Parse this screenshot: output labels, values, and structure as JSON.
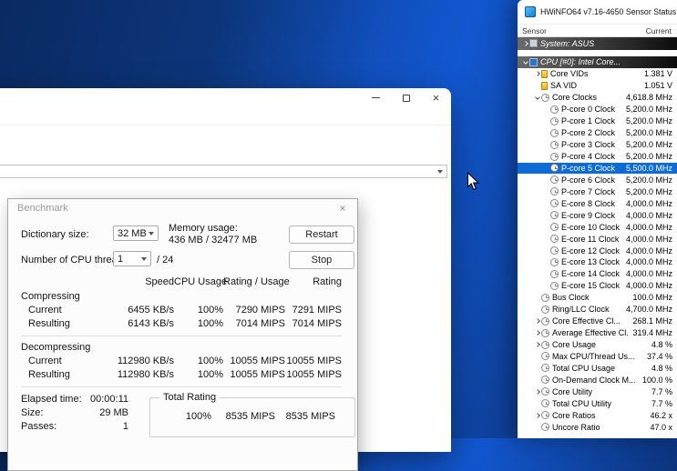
{
  "colors": {
    "desktop_blue": "#1257d0",
    "selection_blue": "#0d6bd7",
    "group_row_dark": "#0c0c0c",
    "vid_icon_yellow": "#f0b01e"
  },
  "main_window": {
    "close_glyph": "×"
  },
  "benchmark": {
    "title": "Benchmark",
    "close_glyph": "×",
    "dictionary_label": "Dictionary size:",
    "dictionary_value": "32 MB",
    "memory_label": "Memory usage:",
    "memory_value": "436 MB / 32477 MB",
    "restart_label": "Restart",
    "threads_label": "Number of CPU threads:",
    "threads_value": "1",
    "threads_total": "/ 24",
    "stop_label": "Stop",
    "table": {
      "headers": [
        "Speed",
        "CPU Usage",
        "Rating / Usage",
        "Rating"
      ],
      "sections": [
        {
          "name": "Compressing",
          "rows": [
            {
              "label": "Current",
              "speed": "6455 KB/s",
              "cpu": "100%",
              "rating_usage": "7290 MIPS",
              "rating": "7291 MIPS"
            },
            {
              "label": "Resulting",
              "speed": "6143 KB/s",
              "cpu": "100%",
              "rating_usage": "7014 MIPS",
              "rating": "7014 MIPS"
            }
          ]
        },
        {
          "name": "Decompressing",
          "rows": [
            {
              "label": "Current",
              "speed": "112980 KB/s",
              "cpu": "100%",
              "rating_usage": "10055 MIPS",
              "rating": "10055 MIPS"
            },
            {
              "label": "Resulting",
              "speed": "112980 KB/s",
              "cpu": "100%",
              "rating_usage": "10055 MIPS",
              "rating": "10055 MIPS"
            }
          ]
        }
      ]
    },
    "stats": [
      {
        "label": "Elapsed time:",
        "value": "00:00:11"
      },
      {
        "label": "Size:",
        "value": "29 MB"
      },
      {
        "label": "Passes:",
        "value": "1"
      }
    ],
    "total_rating": {
      "legend": "Total Rating",
      "cpu": "100%",
      "rating_usage": "8535 MIPS",
      "rating": "8535 MIPS"
    }
  },
  "hwinfo": {
    "title": "HWiNFO64 v7.16-4650 Sensor Status",
    "columns": {
      "sensor": "Sensor",
      "current": "Current"
    },
    "rows": [
      {
        "kind": "group",
        "chevron": "right",
        "icon": "system",
        "label": "System: ASUS"
      },
      {
        "kind": "gap"
      },
      {
        "kind": "group",
        "chevron": "down",
        "icon": "cpu",
        "label": "CPU [#0]: Intel Core..."
      },
      {
        "kind": "item",
        "indent": 1,
        "chevron": "right",
        "icon": "vid",
        "label": "Core VIDs",
        "value": "1.381 V"
      },
      {
        "kind": "item",
        "indent": 1,
        "icon": "vid",
        "label": "SA VID",
        "value": "1.051 V"
      },
      {
        "kind": "item",
        "indent": 1,
        "chevron": "down",
        "icon": "clock",
        "label": "Core Clocks",
        "value": "4,618.8 MHz"
      },
      {
        "kind": "item",
        "indent": 2,
        "icon": "clock",
        "label": "P-core 0 Clock",
        "value": "5,200.0 MHz"
      },
      {
        "kind": "item",
        "indent": 2,
        "icon": "clock",
        "label": "P-core 1 Clock",
        "value": "5,200.0 MHz"
      },
      {
        "kind": "item",
        "indent": 2,
        "icon": "clock",
        "label": "P-core 2 Clock",
        "value": "5,200.0 MHz"
      },
      {
        "kind": "item",
        "indent": 2,
        "icon": "clock",
        "label": "P-core 3 Clock",
        "value": "5,200.0 MHz"
      },
      {
        "kind": "item",
        "indent": 2,
        "icon": "clock",
        "label": "P-core 4 Clock",
        "value": "5,200.0 MHz"
      },
      {
        "kind": "item",
        "indent": 2,
        "icon": "clock",
        "label": "P-core 5 Clock",
        "value": "5,500.0 MHz",
        "selected": true
      },
      {
        "kind": "item",
        "indent": 2,
        "icon": "clock",
        "label": "P-core 6 Clock",
        "value": "5,200.0 MHz"
      },
      {
        "kind": "item",
        "indent": 2,
        "icon": "clock",
        "label": "P-core 7 Clock",
        "value": "5,200.0 MHz"
      },
      {
        "kind": "item",
        "indent": 2,
        "icon": "clock",
        "label": "E-core 8 Clock",
        "value": "4,000.0 MHz"
      },
      {
        "kind": "item",
        "indent": 2,
        "icon": "clock",
        "label": "E-core 9 Clock",
        "value": "4,000.0 MHz"
      },
      {
        "kind": "item",
        "indent": 2,
        "icon": "clock",
        "label": "E-core 10 Clock",
        "value": "4,000.0 MHz"
      },
      {
        "kind": "item",
        "indent": 2,
        "icon": "clock",
        "label": "E-core 11 Clock",
        "value": "4,000.0 MHz"
      },
      {
        "kind": "item",
        "indent": 2,
        "icon": "clock",
        "label": "E-core 12 Clock",
        "value": "4,000.0 MHz"
      },
      {
        "kind": "item",
        "indent": 2,
        "icon": "clock",
        "label": "E-core 13 Clock",
        "value": "4,000.0 MHz"
      },
      {
        "kind": "item",
        "indent": 2,
        "icon": "clock",
        "label": "E-core 14 Clock",
        "value": "4,000.0 MHz"
      },
      {
        "kind": "item",
        "indent": 2,
        "icon": "clock",
        "label": "E-core 15 Clock",
        "value": "4,000.0 MHz"
      },
      {
        "kind": "item",
        "indent": 1,
        "icon": "clock",
        "label": "Bus Clock",
        "value": "100.0 MHz"
      },
      {
        "kind": "item",
        "indent": 1,
        "icon": "clock",
        "label": "Ring/LLC Clock",
        "value": "4,700.0 MHz"
      },
      {
        "kind": "item",
        "indent": 1,
        "chevron": "right",
        "icon": "clock",
        "label": "Core Effective Cl...",
        "value": "268.1 MHz"
      },
      {
        "kind": "item",
        "indent": 1,
        "chevron": "right",
        "icon": "clock",
        "label": "Average Effective Cl...",
        "value": "319.4 MHz"
      },
      {
        "kind": "item",
        "indent": 1,
        "chevron": "right",
        "icon": "clock",
        "label": "Core Usage",
        "value": "4.8 %"
      },
      {
        "kind": "item",
        "indent": 1,
        "icon": "clock",
        "label": "Max CPU/Thread Us...",
        "value": "37.4 %"
      },
      {
        "kind": "item",
        "indent": 1,
        "icon": "clock",
        "label": "Total CPU Usage",
        "value": "4.8 %"
      },
      {
        "kind": "item",
        "indent": 1,
        "icon": "clock",
        "label": "On-Demand Clock M...",
        "value": "100.0 %"
      },
      {
        "kind": "item",
        "indent": 1,
        "chevron": "right",
        "icon": "clock",
        "label": "Core Utility",
        "value": "7.7 %"
      },
      {
        "kind": "item",
        "indent": 1,
        "icon": "clock",
        "label": "Total CPU Utility",
        "value": "7.7 %"
      },
      {
        "kind": "item",
        "indent": 1,
        "chevron": "right",
        "icon": "clock",
        "label": "Core Ratios",
        "value": "46.2 x"
      },
      {
        "kind": "item",
        "indent": 1,
        "icon": "clock",
        "label": "Uncore Ratio",
        "value": "47.0 x"
      }
    ]
  }
}
